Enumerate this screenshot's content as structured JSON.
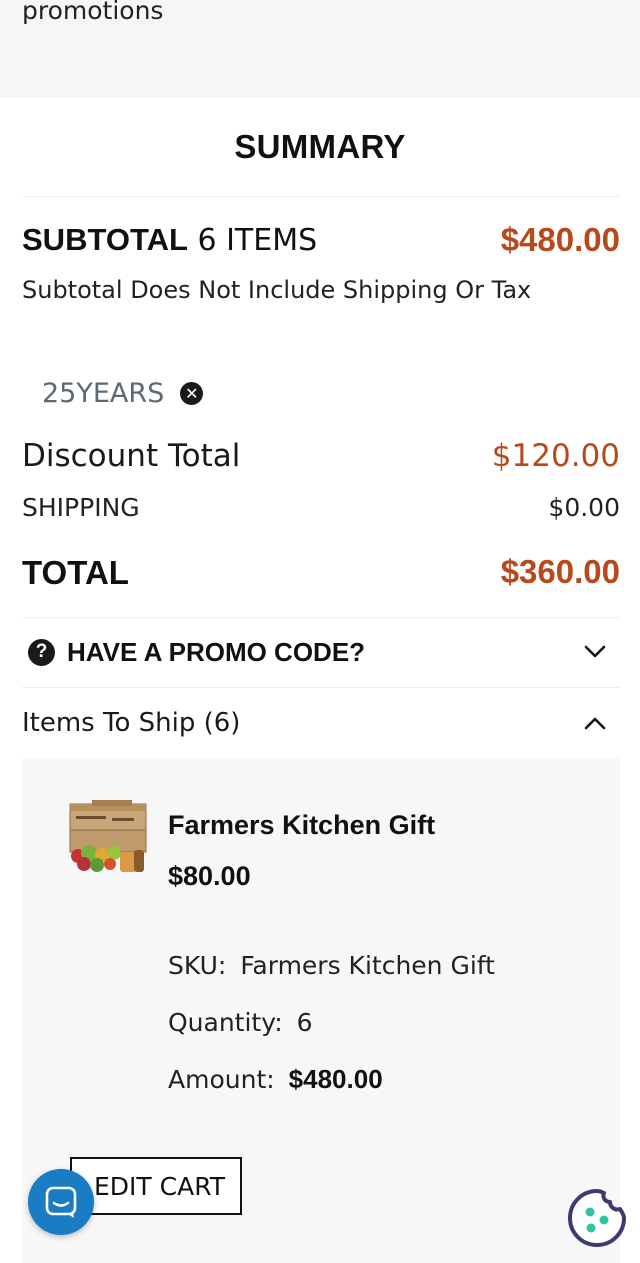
{
  "top": {
    "promo_text": "promotions"
  },
  "summary": {
    "title": "SUMMARY",
    "subtotal_label": "SUBTOTAL",
    "items_count": "6 ITEMS",
    "subtotal_value": "$480.00",
    "subtotal_note": "Subtotal Does Not Include Shipping Or Tax",
    "coupon_code": "25YEARS",
    "discount_label": "Discount Total",
    "discount_value": "$120.00",
    "shipping_label": "SHIPPING",
    "shipping_value": "$0.00",
    "total_label": "TOTAL",
    "total_value": "$360.00"
  },
  "promo": {
    "label": "HAVE A PROMO CODE?"
  },
  "ship": {
    "label": "Items To Ship (6)"
  },
  "item": {
    "name": "Farmers Kitchen Gift",
    "price": "$80.00",
    "sku_label": "SKU:",
    "sku_value": "Farmers Kitchen Gift",
    "qty_label": "Quantity:",
    "qty_value": "6",
    "amount_label": "Amount:",
    "amount_value": "$480.00"
  },
  "actions": {
    "edit_cart": "EDIT CART"
  },
  "colors": {
    "accent": "#b8491b",
    "chat": "#1a7cc3",
    "cookie": "#3d3a73"
  },
  "icons": {
    "coupon_remove": "close-circle-icon",
    "promo": "question-circle-icon",
    "promo_toggle": "chevron-down-icon",
    "ship_toggle": "chevron-up-icon",
    "chat": "chat-icon",
    "cookie": "cookie-icon"
  }
}
